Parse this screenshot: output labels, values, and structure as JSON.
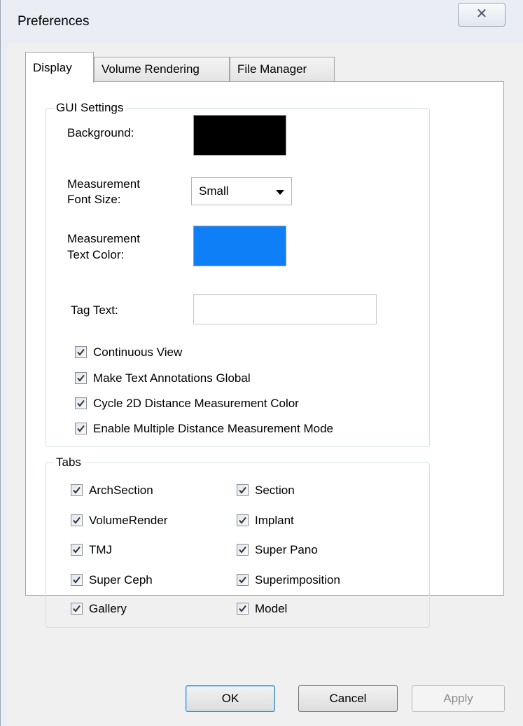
{
  "window": {
    "title": "Preferences",
    "close_glyph": "✕"
  },
  "tabs": [
    "Display",
    "Volume Rendering",
    "File Manager"
  ],
  "gui_settings": {
    "legend": "GUI Settings",
    "background_label": "Background:",
    "background_color": "#000000",
    "font_size_label_line1": "Measurement",
    "font_size_label_line2": "Font Size:",
    "font_size_value": "Small",
    "text_color_label_line1": "Measurement",
    "text_color_label_line2": "Text Color:",
    "text_color": "#0f7ff7",
    "tag_text_label": "Tag Text:",
    "tag_text_value": "",
    "checkboxes": [
      {
        "label": "Continuous View",
        "checked": true
      },
      {
        "label": "Make Text Annotations Global",
        "checked": true
      },
      {
        "label": "Cycle 2D Distance Measurement Color",
        "checked": true
      },
      {
        "label": "Enable Multiple Distance Measurement Mode",
        "checked": true
      }
    ]
  },
  "tabs_group": {
    "legend": "Tabs",
    "left": [
      {
        "label": "ArchSection",
        "checked": true
      },
      {
        "label": "VolumeRender",
        "checked": true
      },
      {
        "label": "TMJ",
        "checked": true
      },
      {
        "label": "Super Ceph",
        "checked": true
      },
      {
        "label": "Gallery",
        "checked": true
      }
    ],
    "right": [
      {
        "label": "Section",
        "checked": true
      },
      {
        "label": "Implant",
        "checked": true
      },
      {
        "label": "Super Pano",
        "checked": true
      },
      {
        "label": "Superimposition",
        "checked": true
      },
      {
        "label": "Model",
        "checked": true
      }
    ]
  },
  "buttons": {
    "ok": "OK",
    "cancel": "Cancel",
    "apply": "Apply"
  }
}
